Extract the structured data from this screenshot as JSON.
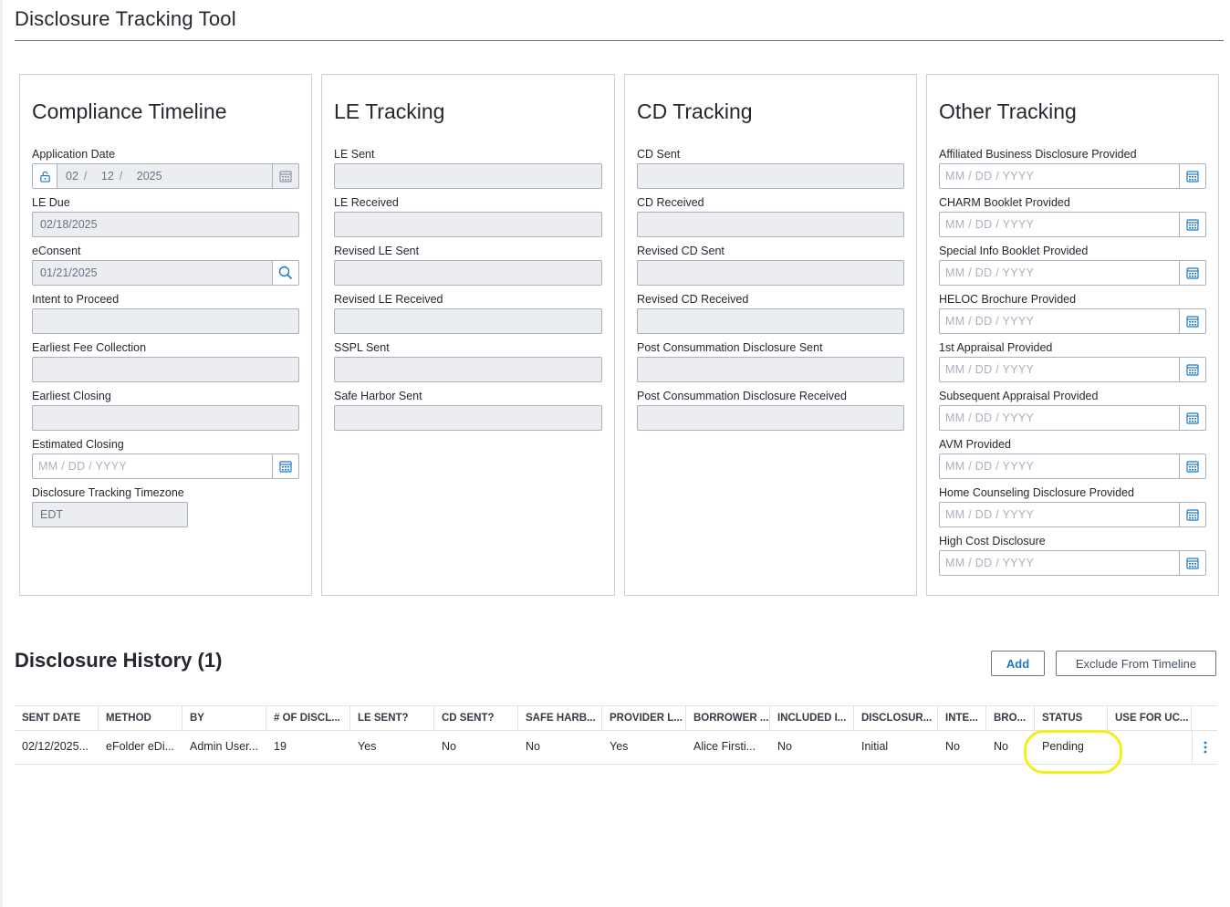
{
  "page": {
    "title": "Disclosure Tracking Tool"
  },
  "compliance": {
    "title": "Compliance Timeline",
    "application_date": {
      "label": "Application Date",
      "mm": "02",
      "dd": "12",
      "yyyy": "2025"
    },
    "le_due": {
      "label": "LE Due",
      "value": "02/18/2025"
    },
    "econsent": {
      "label": "eConsent",
      "value": "01/21/2025"
    },
    "intent_to_proceed": {
      "label": "Intent to Proceed",
      "value": ""
    },
    "earliest_fee_collection": {
      "label": "Earliest Fee Collection",
      "value": ""
    },
    "earliest_closing": {
      "label": "Earliest Closing",
      "value": ""
    },
    "estimated_closing": {
      "label": "Estimated Closing",
      "placeholder_mm": "MM",
      "placeholder_dd": "DD",
      "placeholder_yyyy": "YYYY"
    },
    "timezone": {
      "label": "Disclosure Tracking Timezone",
      "value": "EDT"
    }
  },
  "le_tracking": {
    "title": "LE Tracking",
    "fields": [
      "LE Sent",
      "LE Received",
      "Revised LE Sent",
      "Revised LE Received",
      "SSPL Sent",
      "Safe Harbor Sent"
    ]
  },
  "cd_tracking": {
    "title": "CD Tracking",
    "fields": [
      "CD Sent",
      "CD Received",
      "Revised CD Sent",
      "Revised CD Received",
      "Post Consummation Disclosure Sent",
      "Post Consummation Disclosure Received"
    ]
  },
  "other_tracking": {
    "title": "Other Tracking",
    "date_placeholder": {
      "mm": "MM",
      "dd": "DD",
      "yyyy": "YYYY",
      "sep": "/"
    },
    "fields": [
      "Affiliated Business Disclosure Provided",
      "CHARM Booklet Provided",
      "Special Info Booklet Provided",
      "HELOC Brochure Provided",
      "1st Appraisal Provided",
      "Subsequent Appraisal Provided",
      "AVM Provided",
      "Home Counseling Disclosure Provided",
      "High Cost Disclosure"
    ]
  },
  "history": {
    "title": "Disclosure History (1)",
    "add_label": "Add",
    "exclude_label": "Exclude From Timeline",
    "columns": [
      "SENT DATE",
      "METHOD",
      "BY",
      "# OF DISCL...",
      "LE SENT?",
      "CD SENT?",
      "SAFE HARB...",
      "PROVIDER L...",
      "BORROWER ...",
      "INCLUDED I...",
      "DISCLOSUR...",
      "INTE...",
      "BRO...",
      "STATUS",
      "USE FOR UC..."
    ],
    "rows": [
      [
        "02/12/2025...",
        "eFolder eDi...",
        "Admin User...",
        "19",
        "Yes",
        "No",
        "No",
        "Yes",
        "Alice Firsti...",
        "No",
        "Initial",
        "No",
        "No",
        "Pending",
        ""
      ]
    ]
  },
  "icons": {
    "calendar": "calendar-icon",
    "search": "search-icon",
    "unlock": "unlock-icon",
    "more": "more-vertical-icon"
  },
  "colors": {
    "accent": "#1e79c2",
    "highlight": "#f2f01a"
  }
}
